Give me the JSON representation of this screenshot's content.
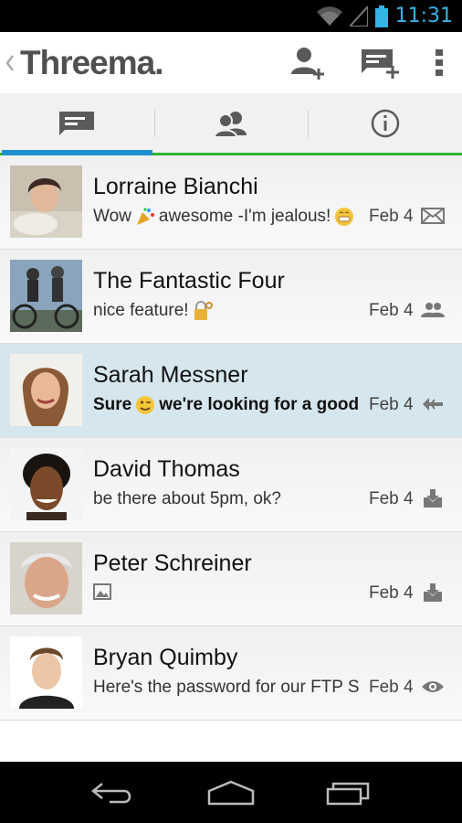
{
  "status_bar": {
    "time": "11:31",
    "accent": "#33b5e5",
    "icons": [
      "wifi-icon",
      "signal-icon",
      "battery-icon"
    ]
  },
  "action_bar": {
    "title": "Threema.",
    "actions": [
      {
        "name": "add-contact",
        "icon": "add-contact-icon"
      },
      {
        "name": "new-message",
        "icon": "new-message-icon"
      },
      {
        "name": "overflow-menu",
        "icon": "overflow-icon"
      }
    ]
  },
  "tabs": [
    {
      "name": "conversations",
      "icon": "chat-icon",
      "active": true
    },
    {
      "name": "contacts",
      "icon": "contacts-icon",
      "active": false
    },
    {
      "name": "info",
      "icon": "info-icon",
      "active": false
    }
  ],
  "colors": {
    "active_tab": "#1e90d0",
    "tab_underline": "#2fb52f",
    "selected_row": "#d6e6ee"
  },
  "conversations": [
    {
      "name": "Lorraine Bianchi",
      "preview_a": "Wow",
      "preview_b": "awesome -I'm jealous!",
      "date": "Feb 4",
      "status_icon": "envelope-icon",
      "emoji": [
        "party-popper-emoji",
        "grin-emoji"
      ]
    },
    {
      "name": "The Fantastic Four",
      "preview_a": "nice feature!",
      "preview_b": "",
      "date": "Feb 4",
      "status_icon": "group-icon",
      "emoji": [
        "lock-key-emoji"
      ]
    },
    {
      "name": "Sarah Messner",
      "preview_a": "Sure",
      "preview_b": "we're looking for a good",
      "date": "Feb 4",
      "status_icon": "reply-icon",
      "emoji": [
        "wink-emoji"
      ],
      "selected": true
    },
    {
      "name": "David Thomas",
      "preview_a": "be there about 5pm, ok?",
      "preview_b": "",
      "date": "Feb 4",
      "status_icon": "download-icon"
    },
    {
      "name": "Peter Schreiner",
      "preview_a": "",
      "preview_b": "",
      "date": "Feb 4",
      "status_icon": "download-icon",
      "attachment_icon": "image-icon"
    },
    {
      "name": "Bryan Quimby",
      "preview_a": "Here's the password for our FTP S",
      "preview_b": "",
      "date": "Feb 4",
      "status_icon": "eye-icon"
    }
  ],
  "nav_bar": [
    "back-icon",
    "home-icon",
    "recents-icon"
  ]
}
